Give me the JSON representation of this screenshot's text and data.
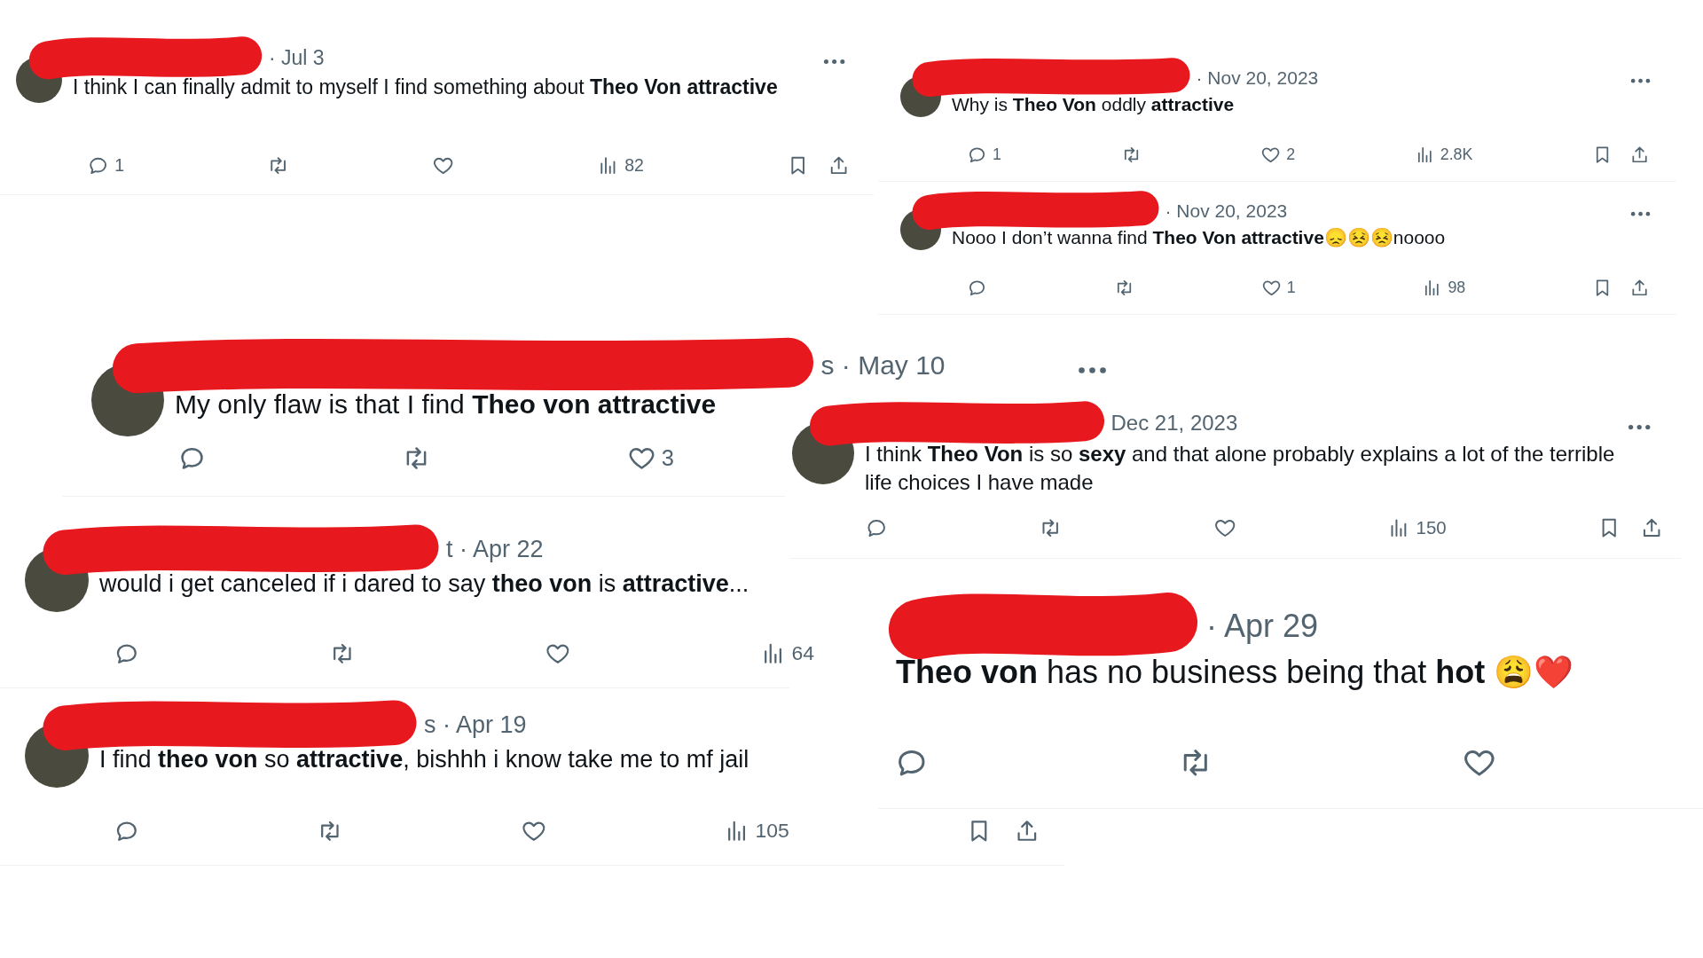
{
  "tweets": [
    {
      "date": "· Jul 3",
      "text": "I think I can finally admit to myself I find something about **Theo Von attractive**",
      "actions": [
        {
          "kind": "reply",
          "count": "1"
        },
        {
          "kind": "retweet"
        },
        {
          "kind": "like"
        },
        {
          "kind": "views",
          "count": "82"
        },
        {
          "kind": "bookmark"
        },
        {
          "kind": "share"
        }
      ]
    },
    {
      "date": "· Nov 20, 2023",
      "text": "Why is **Theo Von** oddly **attractive**",
      "actions": [
        {
          "kind": "reply",
          "count": "1"
        },
        {
          "kind": "retweet"
        },
        {
          "kind": "like",
          "count": "2"
        },
        {
          "kind": "views",
          "count": "2.8K"
        },
        {
          "kind": "bookmark"
        },
        {
          "kind": "share"
        }
      ]
    },
    {
      "date": "· Nov 20, 2023",
      "text": "Nooo I don’t wanna find **Theo Von attractive**😞😣😣noooo",
      "actions": [
        {
          "kind": "reply"
        },
        {
          "kind": "retweet"
        },
        {
          "kind": "like",
          "count": "1"
        },
        {
          "kind": "views",
          "count": "98"
        },
        {
          "kind": "bookmark"
        },
        {
          "kind": "share"
        }
      ]
    },
    {
      "date": "s · May 10",
      "text": "My only flaw is that I find **Theo von attractive**",
      "actions": [
        {
          "kind": "reply"
        },
        {
          "kind": "retweet"
        },
        {
          "kind": "like",
          "count": "3"
        }
      ]
    },
    {
      "date": "Dec 21, 2023",
      "text": "I think **Theo Von** is so **sexy** and that alone probably explains a lot of the terrible life choices I have made",
      "actions": [
        {
          "kind": "reply"
        },
        {
          "kind": "retweet"
        },
        {
          "kind": "like"
        },
        {
          "kind": "views",
          "count": "150"
        },
        {
          "kind": "bookmark"
        },
        {
          "kind": "share"
        }
      ]
    },
    {
      "date": "t · Apr 22",
      "text": "would i get canceled if i dared to say **theo von** is **attractive**...",
      "actions": [
        {
          "kind": "reply"
        },
        {
          "kind": "retweet"
        },
        {
          "kind": "like"
        },
        {
          "kind": "views",
          "count": "64"
        }
      ]
    },
    {
      "date": "s · Apr 19",
      "text": "I find **theo von** so **attractive**, bishhh i know take me to mf jail",
      "actions": [
        {
          "kind": "reply"
        },
        {
          "kind": "retweet"
        },
        {
          "kind": "like"
        },
        {
          "kind": "views",
          "count": "105"
        },
        {
          "kind": "bookmark"
        },
        {
          "kind": "share"
        }
      ]
    },
    {
      "date": "· Apr 29",
      "text": "**Theo von** has no business being that **hot** 😩❤️",
      "actions": [
        {
          "kind": "reply"
        },
        {
          "kind": "retweet"
        },
        {
          "kind": "like"
        }
      ]
    }
  ]
}
